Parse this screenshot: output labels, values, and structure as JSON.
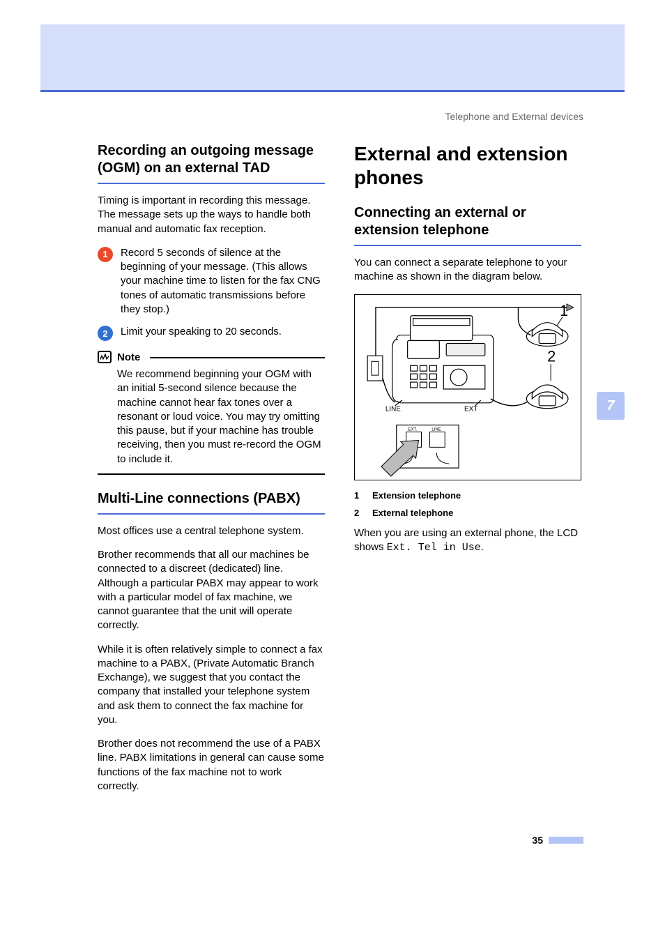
{
  "running_head": "Telephone and External devices",
  "side_tab": "7",
  "page_number": "35",
  "left": {
    "h_ogm": "Recording an outgoing message (OGM) on an external TAD",
    "p_ogm_intro": "Timing is important in recording this message. The message sets up the ways to handle both manual and automatic fax reception.",
    "step1": "Record 5 seconds of silence at the beginning of your message. (This allows your machine time to listen for the fax CNG tones of automatic transmissions before they stop.)",
    "step2": "Limit your speaking to 20 seconds.",
    "note_label": "Note",
    "note_body": "We recommend beginning your OGM with an initial 5-second silence because the machine cannot hear fax tones over a resonant or loud voice. You may try omitting this pause, but if your machine has trouble receiving, then you must re-record the OGM to include it.",
    "h_pabx": "Multi-Line connections (PABX)",
    "p_pabx_1": "Most offices use a central telephone system.",
    "p_pabx_2": "Brother recommends that all our machines be connected to a discreet (dedicated) line. Although a particular PABX may appear to work with a particular model of fax machine, we cannot guarantee that the unit will operate correctly.",
    "p_pabx_3": "While it is often relatively simple to connect a fax machine to a PABX, (Private Automatic Branch Exchange), we suggest that you contact the company that installed your telephone system and ask them to connect the fax machine for you.",
    "p_pabx_4": "Brother does not recommend the use of a PABX line. PABX limitations in general can cause some functions of the fax machine not to work correctly."
  },
  "right": {
    "h_major": "External and extension phones",
    "h_connect": "Connecting an external or extension telephone",
    "p_connect_intro": "You can connect a separate telephone to your machine as shown in the diagram below.",
    "diagram": {
      "label_line": "LINE",
      "label_ext": "EXT",
      "callout_1": "1",
      "callout_2": "2"
    },
    "legend": {
      "n1": "1",
      "t1": "Extension telephone",
      "n2": "2",
      "t2": "External telephone"
    },
    "p_lcd_prefix": "When you are using an external phone, the LCD shows ",
    "p_lcd_code": "Ext. Tel in Use",
    "p_lcd_suffix": "."
  }
}
